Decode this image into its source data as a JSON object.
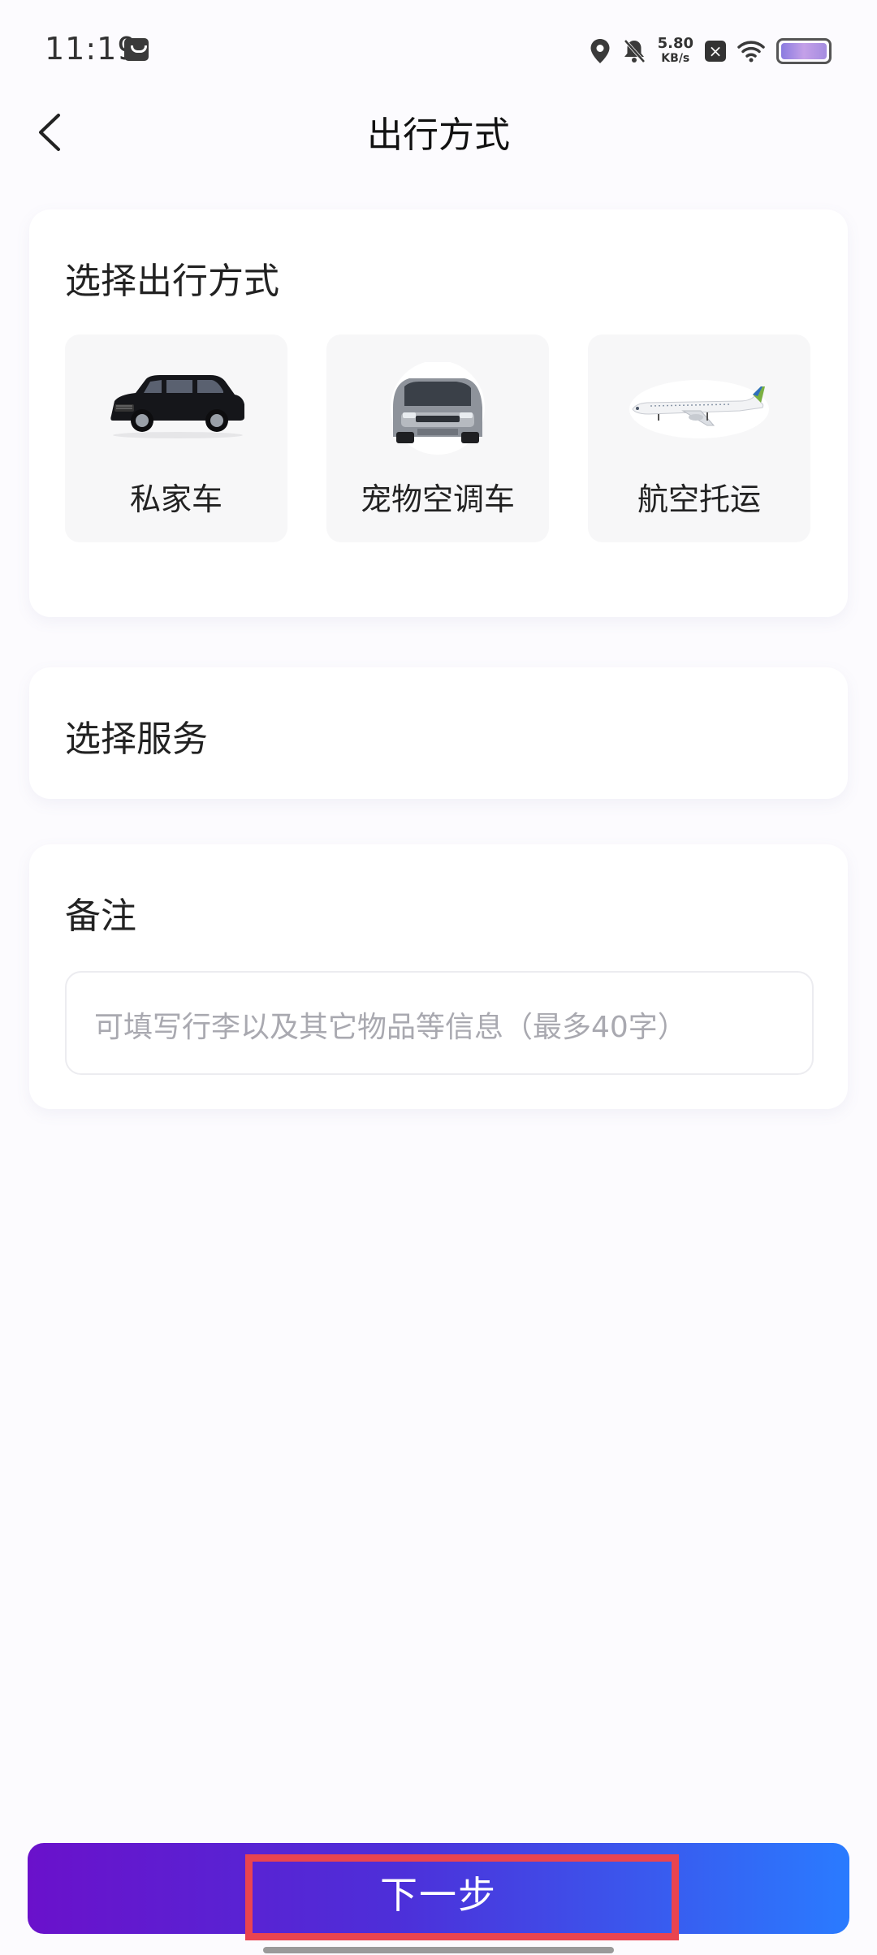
{
  "status_bar": {
    "time": "11:19",
    "net_speed_value": "5.80",
    "net_speed_unit": "KB/s"
  },
  "header": {
    "title": "出行方式",
    "back_icon": "chevron-left-icon"
  },
  "transport_section": {
    "title": "选择出行方式",
    "options": [
      {
        "label": "私家车",
        "icon": "suv-image"
      },
      {
        "label": "宠物空调车",
        "icon": "van-image"
      },
      {
        "label": "航空托运",
        "icon": "airplane-image"
      }
    ]
  },
  "service_section": {
    "title": "选择服务"
  },
  "notes_section": {
    "title": "备注",
    "placeholder": "可填写行李以及其它物品等信息（最多40字）"
  },
  "footer": {
    "next_label": "下一步"
  },
  "colors": {
    "accent_start": "#6a11cb",
    "accent_end": "#2a7bff",
    "highlight": "#e94450"
  }
}
